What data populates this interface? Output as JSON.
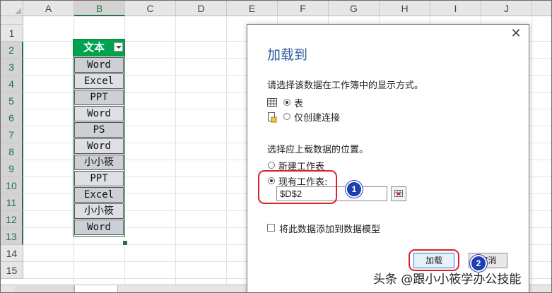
{
  "columns": [
    "A",
    "B",
    "C",
    "D",
    "E",
    "F",
    "G",
    "H",
    "I",
    "J"
  ],
  "selected_column": "B",
  "rows": [
    "1",
    "2",
    "3",
    "4",
    "5",
    "6",
    "7",
    "8",
    "9",
    "10",
    "11",
    "12",
    "13",
    "14",
    "15"
  ],
  "table": {
    "header": "文本",
    "cells": [
      "Word",
      "Excel",
      "PPT",
      "Word",
      "PS",
      "Word",
      "小小筱",
      "PPT",
      "Excel",
      "小小筱",
      "Word"
    ]
  },
  "dialog": {
    "title": "加载到",
    "view_prompt": "请选择该数据在工作簿中的显示方式。",
    "option_table": "表",
    "option_connection_only": "仅创建连接",
    "location_prompt": "选择应上载数据的位置。",
    "option_new_sheet": "新建工作表",
    "option_existing_sheet": "现有工作表:",
    "cell_reference": "$D$2",
    "add_to_model": "将此数据添加到数据模型",
    "load_button": "加载",
    "cancel_button": "取消"
  },
  "annotations": {
    "step1": "1",
    "step2": "2",
    "highlight_color": "#d9222a",
    "badge_color": "#1f3fb0"
  },
  "watermark": "头条 @跟小小筱学办公技能",
  "icons": [
    "close-icon",
    "table-icon",
    "connection-icon",
    "range-select-icon",
    "filter-dropdown-icon"
  ]
}
